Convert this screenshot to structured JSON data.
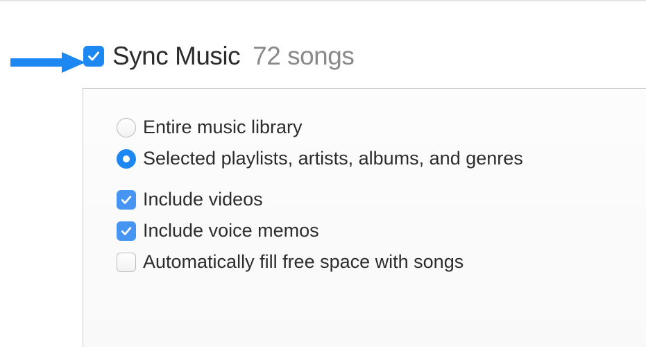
{
  "header": {
    "sync_label": "Sync Music",
    "song_count": "72 songs",
    "checkbox_checked": true
  },
  "options": {
    "radio_entire": "Entire music library",
    "radio_selected": "Selected playlists, artists, albums, and genres",
    "include_videos": "Include videos",
    "include_voice_memos": "Include voice memos",
    "auto_fill": "Automatically fill free space with songs"
  }
}
